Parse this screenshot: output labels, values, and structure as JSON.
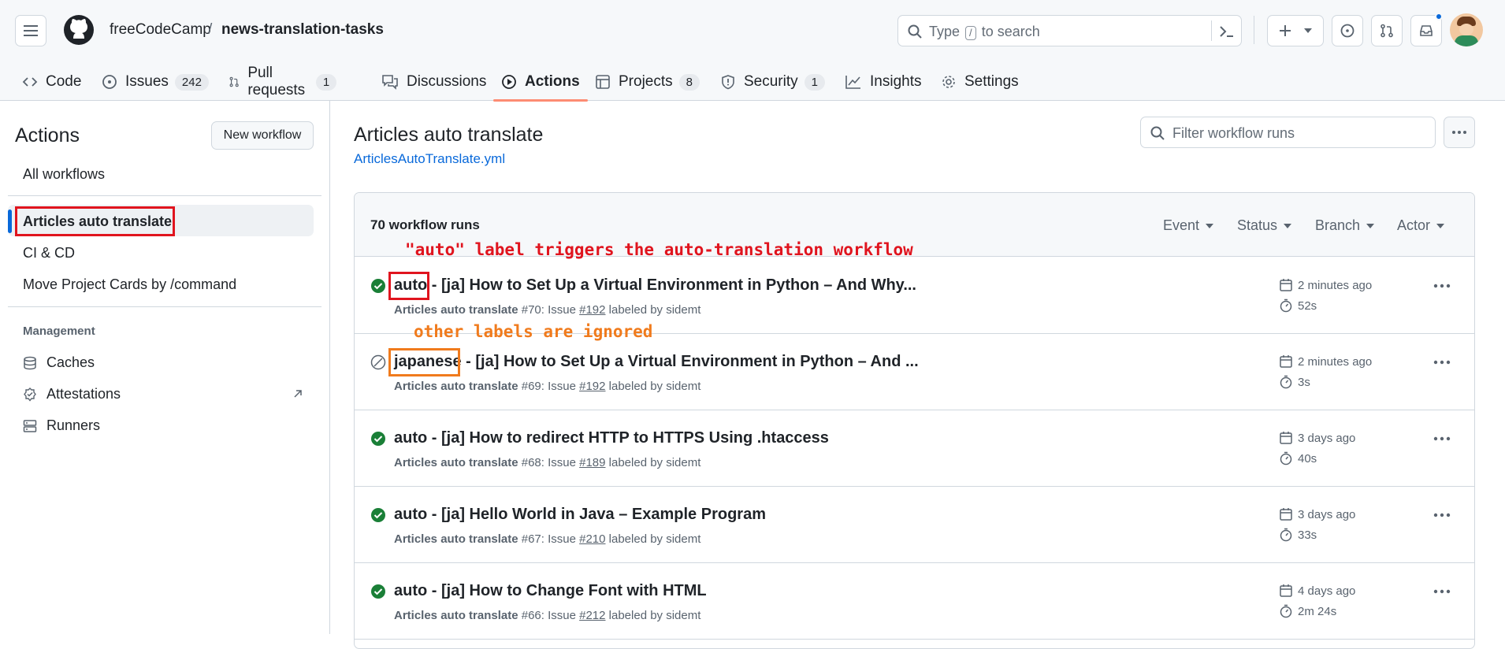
{
  "header": {
    "owner": "freeCodeCamp",
    "separator": "/",
    "repo": "news-translation-tasks",
    "search_text_before": "Type",
    "search_key": "/",
    "search_text_after": "to search"
  },
  "tabs": [
    {
      "label": "Code",
      "icon": "code-icon"
    },
    {
      "label": "Issues",
      "count": "242",
      "icon": "issue-icon"
    },
    {
      "label": "Pull requests",
      "count": "1",
      "icon": "pull-request-icon"
    },
    {
      "label": "Discussions",
      "icon": "discussion-icon"
    },
    {
      "label": "Actions",
      "icon": "play-icon",
      "active": true
    },
    {
      "label": "Projects",
      "count": "8",
      "icon": "table-icon"
    },
    {
      "label": "Security",
      "count": "1",
      "icon": "shield-icon"
    },
    {
      "label": "Insights",
      "icon": "graph-icon"
    },
    {
      "label": "Settings",
      "icon": "gear-icon"
    }
  ],
  "sidebar": {
    "title": "Actions",
    "new_workflow": "New workflow",
    "all_workflows": "All workflows",
    "workflows": [
      "Articles auto translate",
      "CI & CD",
      "Move Project Cards by /command"
    ],
    "management_label": "Management",
    "management": [
      {
        "label": "Caches",
        "icon": "cache-icon"
      },
      {
        "label": "Attestations",
        "icon": "attestation-icon"
      },
      {
        "label": "Runners",
        "icon": "server-icon"
      }
    ]
  },
  "main": {
    "title": "Articles auto translate",
    "file_link": "ArticlesAutoTranslate.yml",
    "filter_placeholder": "Filter workflow runs",
    "runs_count": "70 workflow runs",
    "filters": [
      "Event",
      "Status",
      "Branch",
      "Actor"
    ]
  },
  "annotations": {
    "auto_note": "\"auto\" label triggers the auto-translation workflow",
    "other_note": "other labels are ignored"
  },
  "runs": [
    {
      "status": "success",
      "label": "auto",
      "title_rest": " - [ja] How to Set Up a Virtual Environment in Python – And Why...",
      "workflow": "Articles auto translate",
      "meta_a": " #70: Issue ",
      "issue": "#192",
      "meta_b": " labeled by sidemt",
      "when": "2 minutes ago",
      "duration": "52s"
    },
    {
      "status": "skipped",
      "label": "japanese",
      "title_rest": " - [ja] How to Set Up a Virtual Environment in Python – And ...",
      "workflow": "Articles auto translate",
      "meta_a": " #69: Issue ",
      "issue": "#192",
      "meta_b": " labeled by sidemt",
      "when": "2 minutes ago",
      "duration": "3s"
    },
    {
      "status": "success",
      "label": "auto",
      "title_rest": " - [ja] How to redirect HTTP to HTTPS Using .htaccess",
      "workflow": "Articles auto translate",
      "meta_a": " #68: Issue ",
      "issue": "#189",
      "meta_b": " labeled by sidemt",
      "when": "3 days ago",
      "duration": "40s"
    },
    {
      "status": "success",
      "label": "auto",
      "title_rest": " - [ja] Hello World in Java – Example Program",
      "workflow": "Articles auto translate",
      "meta_a": " #67: Issue ",
      "issue": "#210",
      "meta_b": " labeled by sidemt",
      "when": "3 days ago",
      "duration": "33s"
    },
    {
      "status": "success",
      "label": "auto",
      "title_rest": " - [ja] How to Change Font with HTML",
      "workflow": "Articles auto translate",
      "meta_a": " #66: Issue ",
      "issue": "#212",
      "meta_b": " labeled by sidemt",
      "when": "4 days ago",
      "duration": "2m 24s"
    }
  ],
  "colors": {
    "success": "#1a7f37",
    "link": "#0969da",
    "annot_red": "#e0141e",
    "annot_orange": "#f07b1d"
  }
}
